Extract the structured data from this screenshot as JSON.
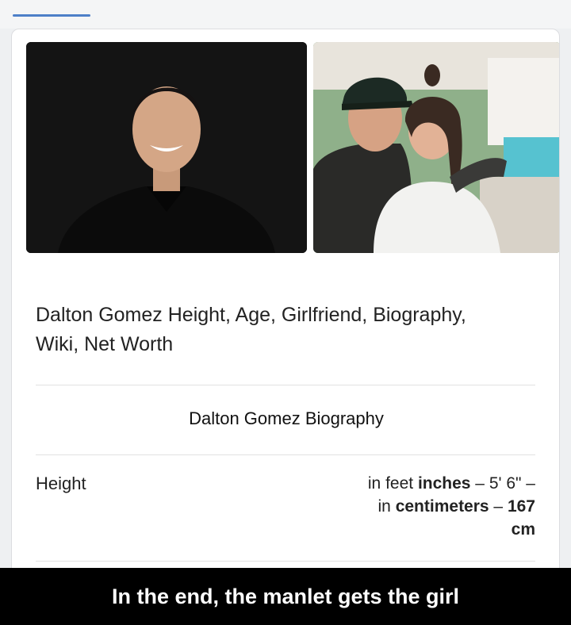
{
  "result": {
    "title": "Dalton Gomez Height, Age, Girlfriend, Biography, Wiki, Net Worth",
    "section_heading": "Dalton Gomez Biography",
    "height_row": {
      "label": "Height",
      "feet_prefix": "in feet ",
      "feet_unit": "inches",
      "feet_value": " – 5' 6\" –",
      "cm_prefix": "in ",
      "cm_unit": "centimeters",
      "cm_dash": " – ",
      "cm_value": "167",
      "cm_suffix": "cm"
    }
  },
  "caption": "In the end, the manlet gets the girl",
  "colors": {
    "accent_tab": "#4d7fc8",
    "caption_bg": "#000000",
    "caption_text": "#ffffff"
  }
}
